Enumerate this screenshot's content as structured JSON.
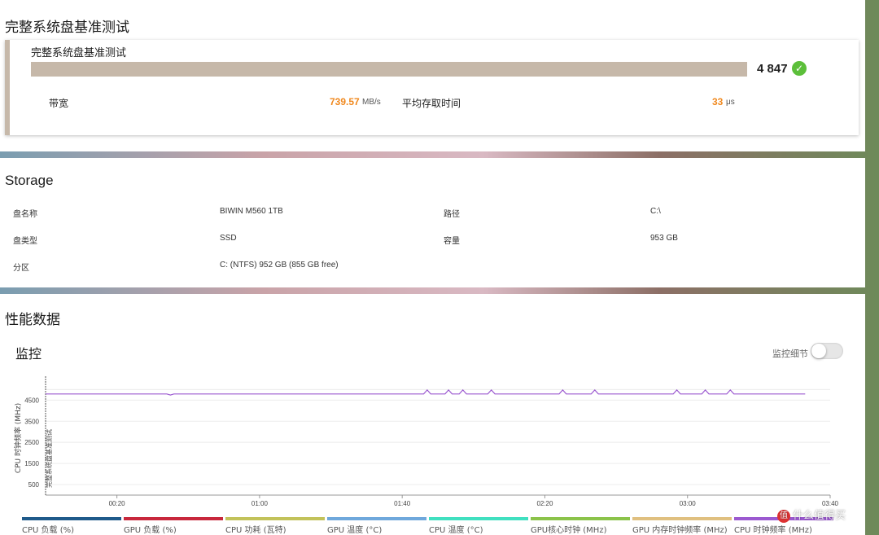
{
  "benchmark": {
    "section_title": "完整系统盘基准测试",
    "card_title": "完整系统盘基准测试",
    "score": "4 847",
    "bandwidth_label": "带宽",
    "bandwidth_value": "739.57",
    "bandwidth_unit": "MB/s",
    "latency_label": "平均存取时间",
    "latency_value": "33",
    "latency_unit": "μs",
    "accent_color": "#f0891f",
    "bar_color": "#c6b8a9"
  },
  "storage": {
    "section_title": "Storage",
    "rows": [
      {
        "label": "盘名称",
        "value": "BIWIN M560 1TB",
        "label2": "路径",
        "value2": "C:\\"
      },
      {
        "label": "盘类型",
        "value": "SSD",
        "label2": "容量",
        "value2": "953 GB"
      },
      {
        "label": "分区",
        "value": "C: (NTFS) 952 GB (855 GB free)",
        "label2": "",
        "value2": ""
      }
    ]
  },
  "performance": {
    "section_title": "性能数据",
    "monitor_title": "监控",
    "toggle_label": "监控细节",
    "toggle_on": false
  },
  "chart_data": {
    "type": "line",
    "ylabel": "CPU 时钟频率 (MHz)",
    "y_ticks": [
      500,
      1500,
      2500,
      3500,
      4500
    ],
    "ylim": [
      0,
      5400
    ],
    "x_ticks": [
      "00:20",
      "01:00",
      "01:40",
      "02:20",
      "03:00",
      "03:40"
    ],
    "x_tick_seconds": [
      20,
      60,
      100,
      140,
      180,
      220
    ],
    "xlim_seconds": [
      0,
      220
    ],
    "marker_label": "完整系统盘基准测试",
    "grid": true,
    "series": [
      {
        "name": "CPU 时钟频率 (MHz)",
        "color": "#9b59d0",
        "points": [
          [
            0,
            4790
          ],
          [
            34,
            4790
          ],
          [
            35,
            4740
          ],
          [
            36,
            4790
          ],
          [
            106,
            4790
          ],
          [
            107,
            4980
          ],
          [
            108,
            4790
          ],
          [
            112,
            4790
          ],
          [
            113,
            4980
          ],
          [
            114,
            4790
          ],
          [
            116,
            4790
          ],
          [
            117,
            4980
          ],
          [
            118,
            4790
          ],
          [
            124,
            4790
          ],
          [
            125,
            4980
          ],
          [
            126,
            4790
          ],
          [
            144,
            4790
          ],
          [
            145,
            4980
          ],
          [
            146,
            4790
          ],
          [
            153,
            4790
          ],
          [
            154,
            4980
          ],
          [
            155,
            4790
          ],
          [
            176,
            4790
          ],
          [
            177,
            4980
          ],
          [
            178,
            4790
          ],
          [
            184,
            4790
          ],
          [
            185,
            4980
          ],
          [
            186,
            4790
          ],
          [
            191,
            4790
          ],
          [
            192,
            4980
          ],
          [
            193,
            4790
          ],
          [
            213,
            4790
          ]
        ]
      }
    ]
  },
  "legend": [
    {
      "label": "CPU 负载 (%)",
      "color": "#1f5a8a"
    },
    {
      "label": "GPU 负载 (%)",
      "color": "#c8283c"
    },
    {
      "label": "CPU 功耗 (瓦特)",
      "color": "#c2c25a"
    },
    {
      "label": "GPU 温度 (°C)",
      "color": "#6fa8dc"
    },
    {
      "label": "CPU 温度 (°C)",
      "color": "#40e0c0"
    },
    {
      "label": "GPU核心时钟 (MHz)",
      "color": "#8bc34a"
    },
    {
      "label": "GPU 内存时钟频率 (MHz)",
      "color": "#e0c080"
    },
    {
      "label": "CPU 时钟频率 (MHz)",
      "color": "#9b59d0"
    }
  ],
  "watermark": {
    "text": "什么值得买",
    "logo": "值"
  }
}
